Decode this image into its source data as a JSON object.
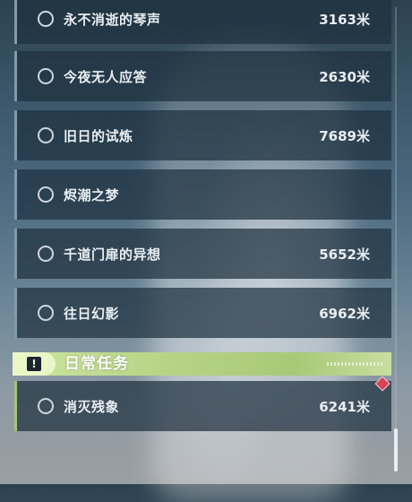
{
  "quests": [
    {
      "name": "永不消逝的琴声",
      "distance": "3163米"
    },
    {
      "name": "今夜无人应答",
      "distance": "2630米"
    },
    {
      "name": "旧日的试炼",
      "distance": "7689米"
    },
    {
      "name": "烬潮之梦",
      "distance": ""
    },
    {
      "name": "千道门扉的异想",
      "distance": "5652米"
    },
    {
      "name": "往日幻影",
      "distance": "6962米"
    }
  ],
  "daily_section": {
    "title": "日常任务",
    "icon": "alert-icon"
  },
  "daily_quests": [
    {
      "name": "消灭残象",
      "distance": "6241米"
    }
  ],
  "colors": {
    "row_bg": "#1e303e",
    "row_accent": "#7e9bb0",
    "daily_accent": "#a8c47a",
    "badge": "#d8415a"
  }
}
